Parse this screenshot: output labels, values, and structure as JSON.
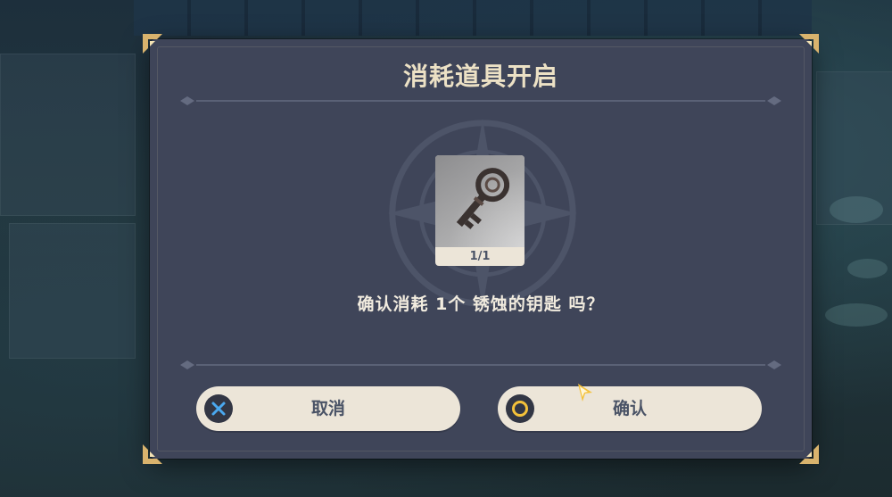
{
  "dialog": {
    "title": "消耗道具开启",
    "item": {
      "name": "锈蚀的钥匙",
      "icon": "rusted-key-icon",
      "count_label": "1/1"
    },
    "message": "确认消耗 1个 锈蚀的钥匙 吗？",
    "buttons": {
      "cancel_label": "取消",
      "cancel_icon": "cross-icon",
      "confirm_label": "确认",
      "confirm_icon": "circle-icon"
    }
  },
  "colors": {
    "panel": "#3f4559",
    "title_text": "#ece1c5",
    "button_bg": "#ece5d8",
    "button_text": "#4a5366",
    "cross_blue": "#4aa8ef",
    "circle_yellow": "#f4c13a",
    "corner_gold": "#d9b36d"
  }
}
